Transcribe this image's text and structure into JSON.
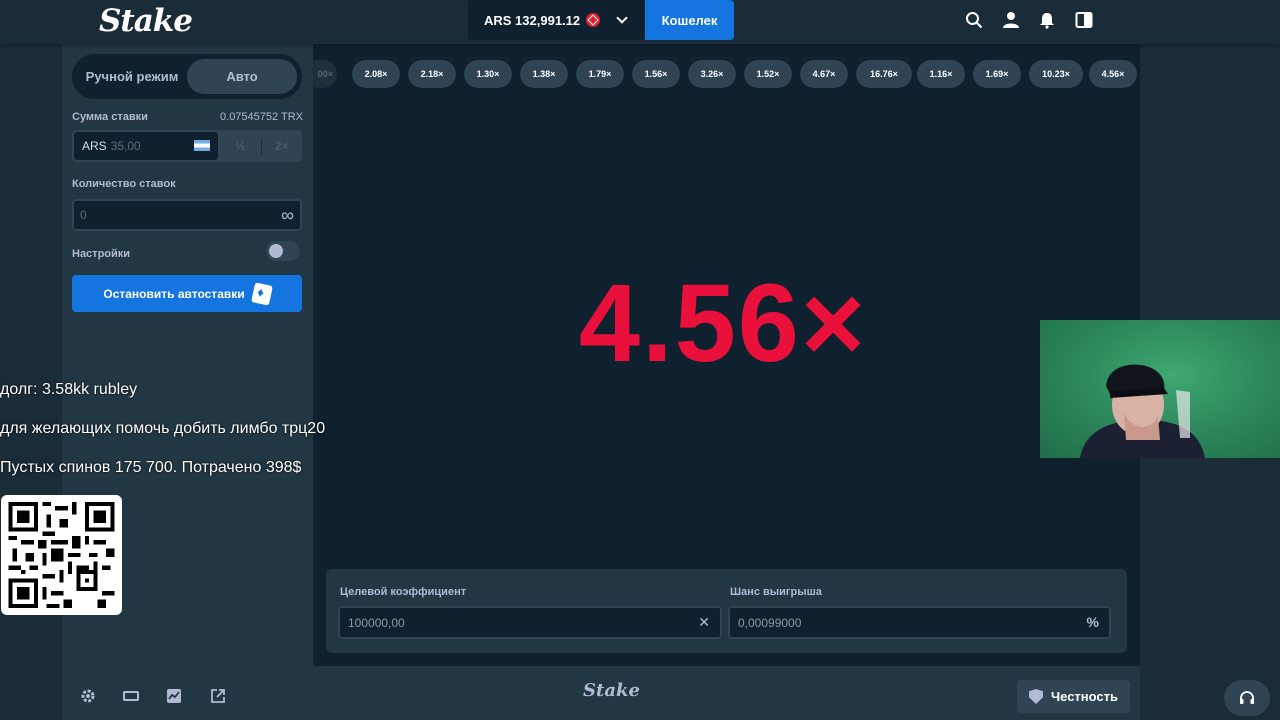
{
  "header": {
    "logo": "Stake",
    "balance": "ARS 132,991.12",
    "wallet_label": "Кошелек",
    "icons": [
      "search-icon",
      "user-icon",
      "notifications-icon",
      "sidebar-toggle-icon"
    ]
  },
  "left_panel": {
    "tabs": [
      {
        "label": "Ручной режим",
        "active": false
      },
      {
        "label": "Авто",
        "active": true
      }
    ],
    "bet_amount_label": "Сумма ставки",
    "bet_amount_crypto": "0.07545752 TRX",
    "bet_currency": "ARS",
    "bet_value": "35,00",
    "half_label": "½",
    "double_label": "2×",
    "bet_count_label": "Количество ставок",
    "bet_count_value": "0",
    "settings_label": "Настройки",
    "settings_enabled": false,
    "stop_button_label": "Остановить автоставки"
  },
  "game": {
    "history_partial": "00×",
    "history": [
      "2.08×",
      "2.18×",
      "1.30×",
      "1.38×",
      "1.79×",
      "1.56×",
      "3.26×",
      "1.52×",
      "4.67×",
      "16.76×",
      "1.16×",
      "1.69×",
      "10.23×",
      "4.56×"
    ],
    "result_multiplier": "4.56×",
    "result_color": "#e9113c",
    "target_label": "Целевой коэффициент",
    "target_value": "100000,00",
    "chance_label": "Шанс выигрыша",
    "chance_value": "0,00099000",
    "chance_suffix": "%"
  },
  "footer": {
    "logo": "Stake",
    "fairness_label": "Честность",
    "icons": [
      "settings-icon",
      "theatre-mode-icon",
      "stats-icon",
      "popout-icon"
    ]
  },
  "overlay": {
    "line1": "долг: 3.58kk rubley",
    "line2": "для желающих помочь добить лимбо трц20",
    "line3": "Пустых спинов 175 700. Потрачено 398$"
  },
  "colors": {
    "bg": "#1a2c38",
    "panel": "#213743",
    "game_bg": "#0f212e",
    "accent_blue": "#1475e1",
    "result_red": "#e9113c"
  }
}
